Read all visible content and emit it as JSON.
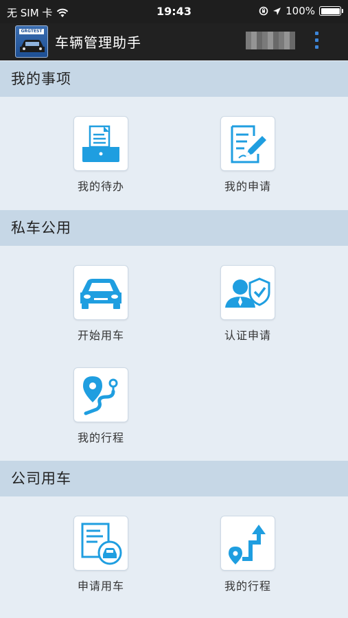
{
  "status_bar": {
    "carrier": "无 SIM 卡",
    "time": "19:43",
    "battery": "100%",
    "battery_level": 1.0,
    "icons": [
      "wifi-icon",
      "orientation-lock-icon",
      "location-arrow-icon",
      "battery-icon"
    ]
  },
  "app_bar": {
    "title": "车辆管理助手",
    "logo_text": "GRGTEST",
    "menu_icon": "more-vertical-icon"
  },
  "colors": {
    "accent": "#1f9ee0",
    "header_bg": "#c6d7e6",
    "page_bg": "#e6edf4",
    "appbar_bg": "#212121"
  },
  "sections": [
    {
      "title": "我的事项",
      "items": [
        {
          "label": "我的待办",
          "icon": "inbox-document-icon"
        },
        {
          "label": "我的申请",
          "icon": "edit-document-icon"
        }
      ]
    },
    {
      "title": "私车公用",
      "items": [
        {
          "label": "开始用车",
          "icon": "car-icon"
        },
        {
          "label": "认证申请",
          "icon": "user-verified-icon"
        },
        {
          "label": "我的行程",
          "icon": "route-pin-icon"
        }
      ]
    },
    {
      "title": "公司用车",
      "items": [
        {
          "label": "申请用车",
          "icon": "car-request-icon"
        },
        {
          "label": "我的行程",
          "icon": "route-arrow-icon"
        }
      ]
    }
  ]
}
